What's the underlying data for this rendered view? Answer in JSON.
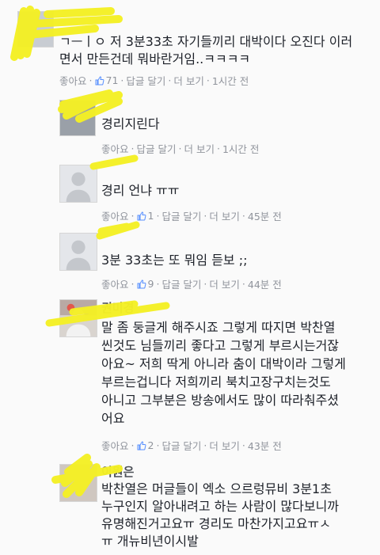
{
  "comments": [
    {
      "name": "",
      "body": "ㄱㅡㅣㅇ 저 3분33초 자기들끼리 대박이다 오진다 이러\n면서 만든건데 뭐바란거임..ㅋㅋㅋㅋ",
      "like": "좋아요",
      "count": "71",
      "reply": "답글 달기",
      "more": "더 보기",
      "time": "1시간 전"
    },
    {
      "name": "",
      "body": "경리지린다",
      "like": "좋아요",
      "count": "",
      "reply": "답글 달기",
      "more": "더 보기",
      "time": "1시간 전"
    },
    {
      "name": "",
      "body": "경리 언냐 ㅠㅠ",
      "like": "좋아요",
      "count": "1",
      "reply": "답글 달기",
      "more": "더 보기",
      "time": "45분 전"
    },
    {
      "name": "",
      "body": "3분 33초는 또 뭐임 듣보 ;;",
      "like": "좋아요",
      "count": "9",
      "reply": "답글 달기",
      "more": "더 보기",
      "time": "44분 전"
    },
    {
      "name": "권미경",
      "body": "말 좀 둥글게 해주시죠 그렇게 따지면 박찬열\n씬것도 님들끼리 좋다고 그렇게 부르시는거잖\n아요~ 저희 딱게 아니라 춤이 대박이라 그렇게\n부르는겁니다 저희끼리 북치고장구치는것도\n아니고 그부분은 방송에서도 많이 따라춰주셨\n어요",
      "like": "좋아요",
      "count": "2",
      "reply": "답글 달기",
      "more": "더 보기",
      "time": "43분 전"
    },
    {
      "name": "이원은",
      "body": "박찬열은 머글들이 엑소 으르렁뮤비 3분1초\n누구인지 알아내려고 하는 사람이 많다보니까\n유명해진거고요ㅠ 경리도 마찬가지고요ㅠㅅ\nㅠ 개뉴비년이시발",
      "like": "",
      "count": "",
      "reply": "",
      "more": "",
      "time": ""
    }
  ],
  "colors": {
    "highlighter": "#f4f025",
    "meta": "#90949c",
    "body": "#1d2129",
    "thumb": "#5890ff"
  },
  "icons": {
    "like_thumb": "thumbs-up-icon",
    "default_avatar": "default-avatar-icon"
  }
}
